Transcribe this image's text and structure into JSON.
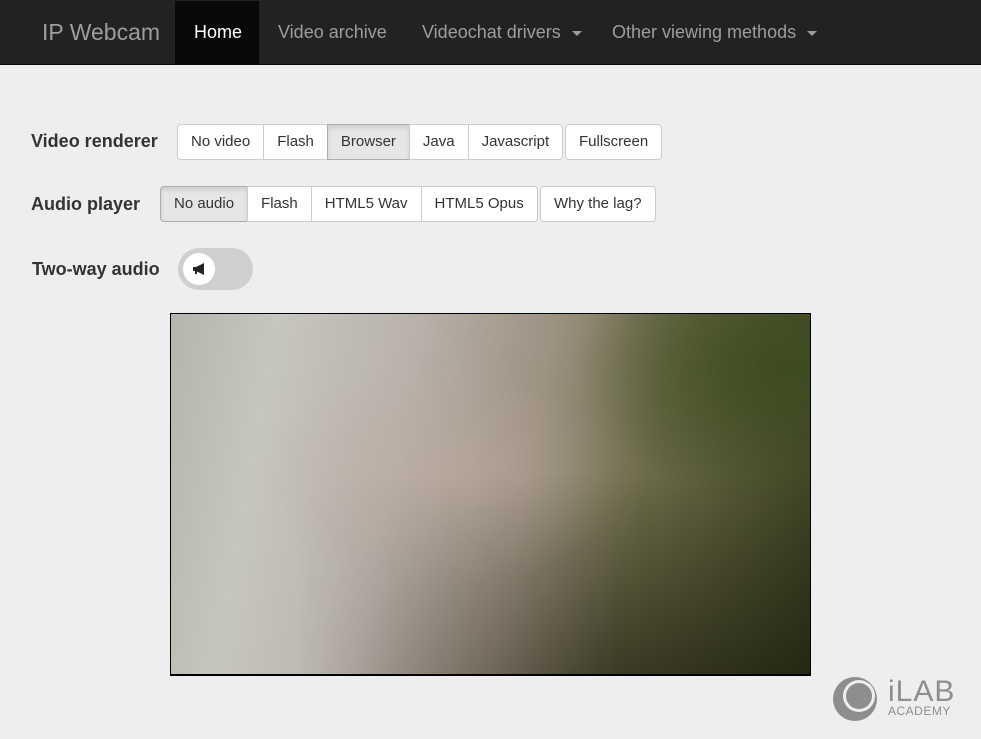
{
  "navbar": {
    "brand": "IP Webcam",
    "items": [
      {
        "label": "Home",
        "active": true
      },
      {
        "label": "Video archive",
        "active": false
      },
      {
        "label": "Videochat drivers",
        "active": false,
        "dropdown": true
      },
      {
        "label": "Other viewing methods",
        "active": false,
        "dropdown": true
      }
    ]
  },
  "video_renderer": {
    "label": "Video renderer",
    "options": [
      "No video",
      "Flash",
      "Browser",
      "Java",
      "Javascript"
    ],
    "selected": "Browser",
    "extra_button": "Fullscreen"
  },
  "audio_player": {
    "label": "Audio player",
    "options": [
      "No audio",
      "Flash",
      "HTML5 Wav",
      "HTML5 Opus"
    ],
    "selected": "No audio",
    "extra_button": "Why the lag?"
  },
  "two_way_audio": {
    "label": "Two-way audio",
    "enabled": false,
    "icon": "megaphone-icon"
  },
  "logo": {
    "main": "iLAB",
    "sub": "ACADEMY"
  },
  "colors": {
    "navbar_bg": "#222222",
    "navbar_active_bg": "#080808",
    "page_bg": "#eeeeee"
  }
}
